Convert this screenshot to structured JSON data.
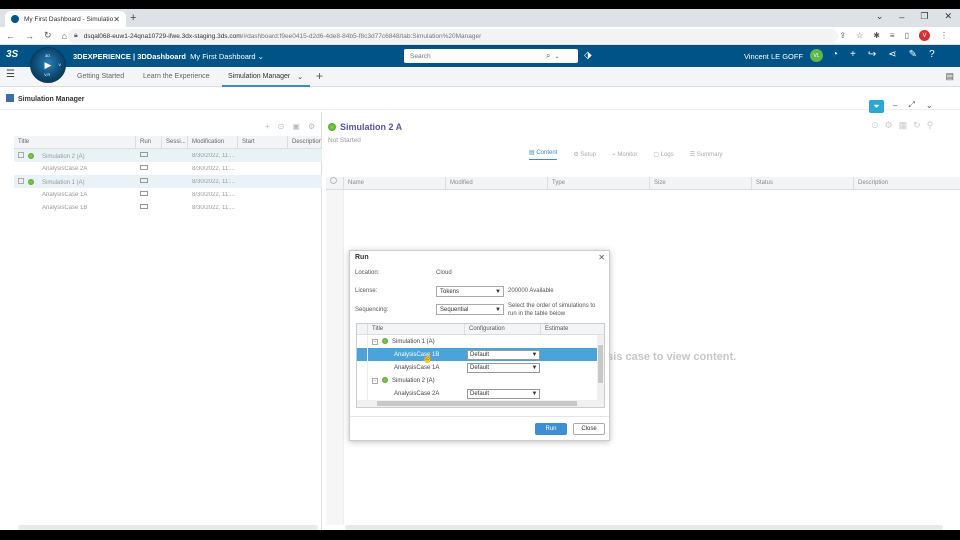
{
  "browser": {
    "tab_title": "My First Dashboard - Simulation",
    "url_host": "dsqal068-euw1-24qna10729-ifwe.3dx-staging.3ds.com",
    "url_rest": "/#dashboard:f9ee0415-d2d6-4de8-84b5-f8c3d77c6848/tab:Simulation%20Manager",
    "profile_initial": "V"
  },
  "topbar": {
    "brand_bold": "3DEXPERIENCE",
    "brand_rest": " | 3DDashboard",
    "dashboard_name": "My First Dashboard",
    "search_placeholder": "Search",
    "user_name": "Vincent LE GOFF",
    "user_initials": "VL",
    "compass_label": "V,R",
    "compass_top": "3D",
    "compass_right": "V"
  },
  "dashboard_tabs": [
    {
      "label": "Getting Started"
    },
    {
      "label": "Learn the Experience"
    },
    {
      "label": "Simulation Manager"
    }
  ],
  "widget": {
    "title": "Simulation Manager"
  },
  "left_table": {
    "columns": [
      "Title",
      "Run",
      "Sessi...",
      "Modification",
      "Start",
      "Description"
    ],
    "rows": [
      {
        "title": "Simulation 2 (A)",
        "modified": "8/30/2022, 11:...",
        "level": 0
      },
      {
        "title": "AnalysisCase 2A",
        "modified": "8/30/2022, 11:...",
        "level": 1
      },
      {
        "title": "Simulation 1 (A)",
        "modified": "8/30/2022, 11:...",
        "level": 0
      },
      {
        "title": "AnalysisCase 1A",
        "modified": "8/30/2022, 11:...",
        "level": 1
      },
      {
        "title": "AnalysisCase 1B",
        "modified": "8/30/2022, 11:...",
        "level": 1
      }
    ]
  },
  "detail": {
    "title": "Simulation 2 A",
    "status": "Not Started",
    "subtabs": [
      "Content",
      "Setup",
      "Monitor",
      "Logs",
      "Summary"
    ],
    "columns": [
      "Name",
      "Modified",
      "Type",
      "Size",
      "Status",
      "Description"
    ],
    "empty_message": "lysis case to view content."
  },
  "run_dialog": {
    "title": "Run",
    "location_label": "Location:",
    "location_value": "Cloud",
    "license_label": "License:",
    "license_value": "Tokens",
    "license_available": "200000 Available",
    "sequencing_label": "Sequencing:",
    "sequencing_value": "Sequential",
    "sequencing_hint": "Select the order of simulations to run in the table below",
    "grid_columns": [
      "Title",
      "Configuration",
      "Estimate"
    ],
    "grid_rows": [
      {
        "title": "Simulation 1 (A)",
        "type": "sim",
        "config": ""
      },
      {
        "title": "AnalysisCase 1B",
        "type": "case",
        "config": "Default"
      },
      {
        "title": "AnalysisCase 1A",
        "type": "case",
        "config": "Default"
      },
      {
        "title": "Simulation 2 (A)",
        "type": "sim",
        "config": ""
      },
      {
        "title": "AnalysisCase 2A",
        "type": "case",
        "config": "Default"
      }
    ],
    "run_button": "Run",
    "close_button": "Close"
  },
  "colors": {
    "topbar": "#005386",
    "accent": "#368ec4",
    "selection": "#4aa3d9",
    "filter": "#29a8d6"
  }
}
